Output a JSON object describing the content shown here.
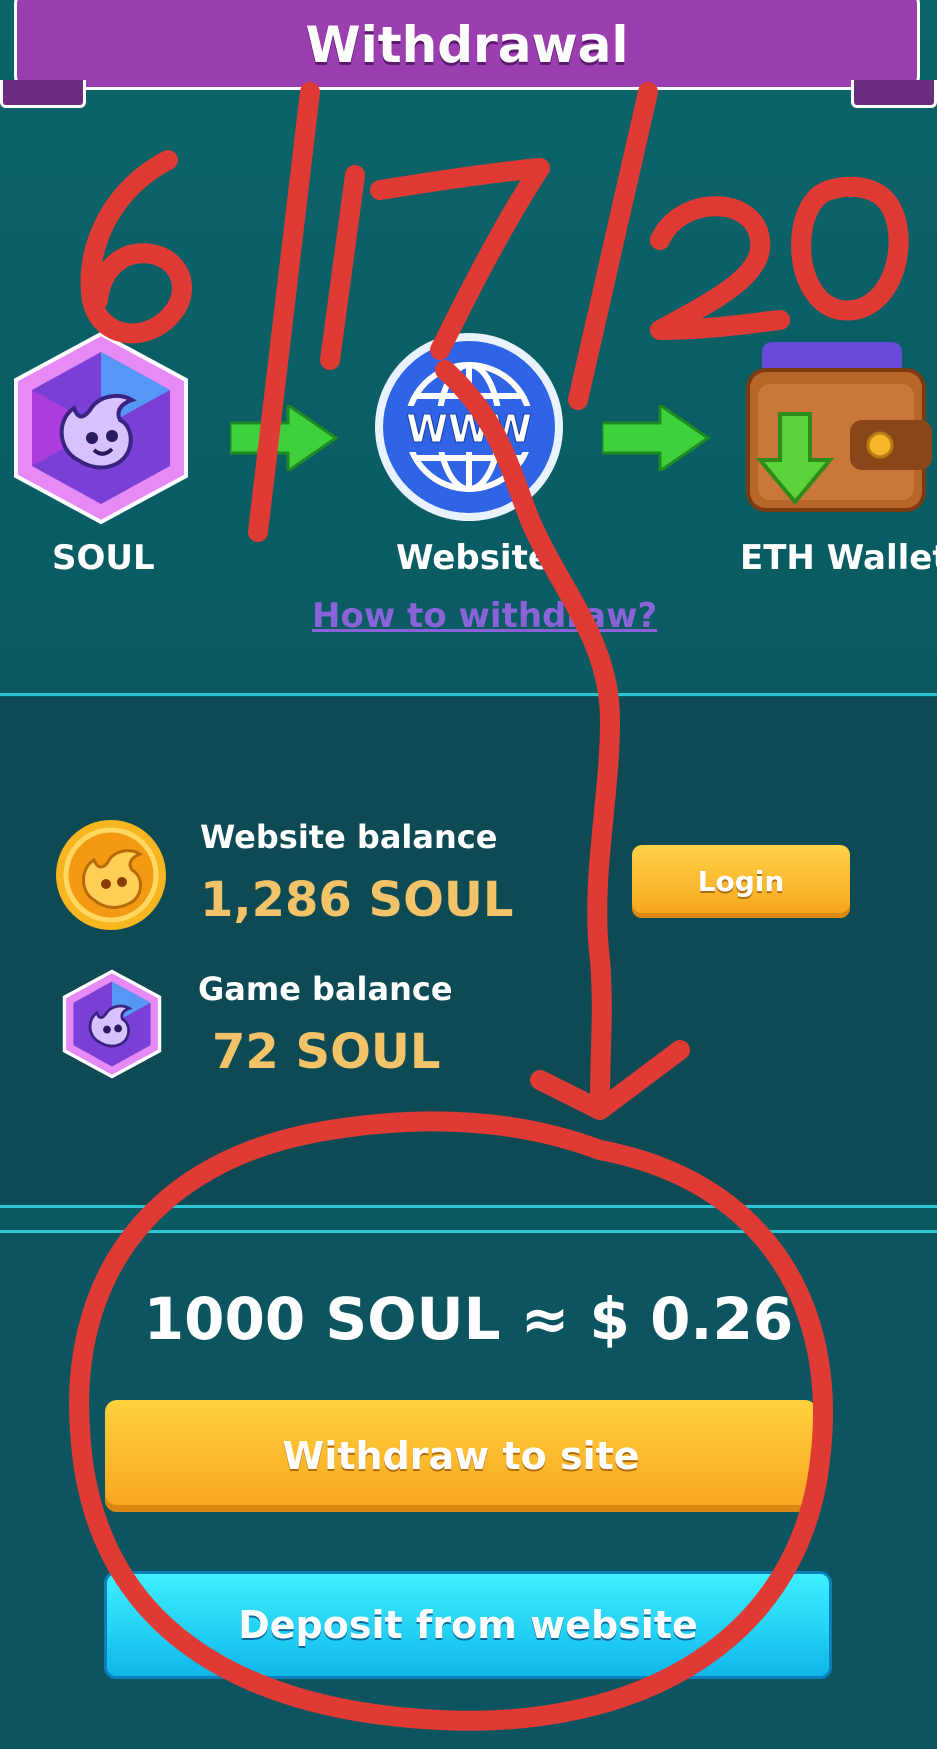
{
  "header": {
    "title": "Withdrawal"
  },
  "flow": {
    "steps": [
      {
        "label": "SOUL",
        "icon": "soul-gem-icon"
      },
      {
        "label": "Website",
        "icon": "www-globe-icon"
      },
      {
        "label": "ETH Wallet",
        "icon": "wallet-icon"
      }
    ],
    "arrow_icon": "green-arrow-icon",
    "help_link": "How to withdraw?"
  },
  "balances": {
    "website": {
      "label": "Website balance",
      "value": "1,286 SOUL",
      "icon": "soul-coin-icon"
    },
    "game": {
      "label": "Game balance",
      "value": "72 SOUL",
      "icon": "soul-gem-icon"
    },
    "login_label": "Login"
  },
  "exchange": {
    "rate_text": "1000 SOUL ≈ $ 0.26"
  },
  "actions": {
    "withdraw_label": "Withdraw to site",
    "deposit_label": "Deposit from website"
  },
  "annotation": {
    "handwritten_date": "6/17/20",
    "color": "#e03a35"
  },
  "colors": {
    "header_purple": "#9b3fb0",
    "value_gold": "#f3c36a",
    "button_orange": "#f7a51e",
    "button_cyan": "#1fc8f0",
    "link_purple": "#8a63d8"
  }
}
